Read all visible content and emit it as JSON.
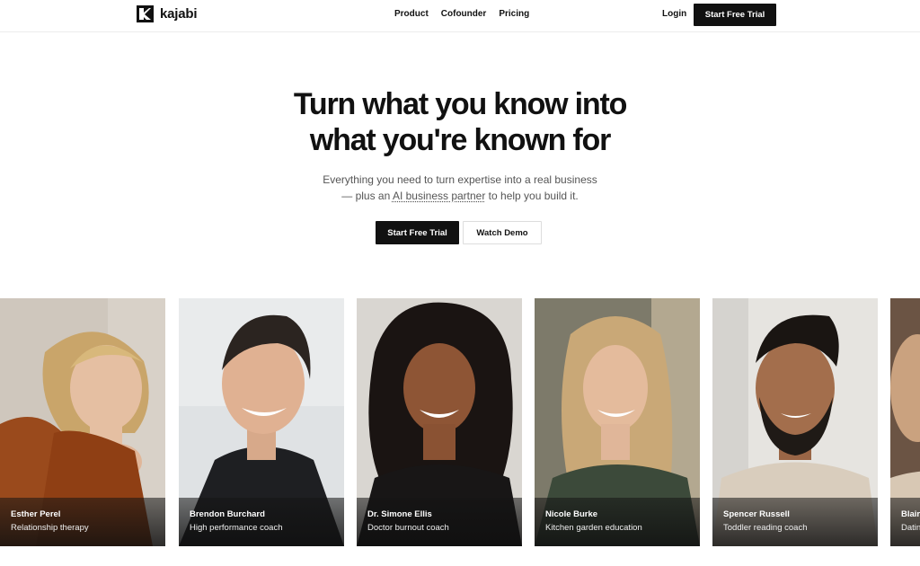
{
  "nav": {
    "logo_text": "kajabi",
    "links": [
      "Product",
      "Cofounder",
      "Pricing"
    ],
    "login": "Login",
    "cta": "Start Free Trial"
  },
  "hero": {
    "title_line1": "Turn what you know into",
    "title_line2": "what you're known for",
    "subtitle_line1": "Everything you need to turn expertise into a real business",
    "subtitle_line2_prefix": "— plus an ",
    "subtitle_link": "AI business partner",
    "subtitle_line2_suffix": " to help you build it.",
    "primary_button": "Start Free Trial",
    "secondary_button": "Watch Demo"
  },
  "creators": [
    {
      "name": "Esther Perel",
      "role": "Relationship therapy"
    },
    {
      "name": "Brendon Burchard",
      "role": "High performance coach"
    },
    {
      "name": "Dr. Simone Ellis",
      "role": "Doctor burnout coach"
    },
    {
      "name": "Nicole Burke",
      "role": "Kitchen garden education"
    },
    {
      "name": "Spencer Russell",
      "role": "Toddler reading coach"
    },
    {
      "name": "Blair",
      "role": "Dating"
    }
  ],
  "colors": {
    "primary": "#111111",
    "background": "#ffffff",
    "text_muted": "#555555"
  }
}
